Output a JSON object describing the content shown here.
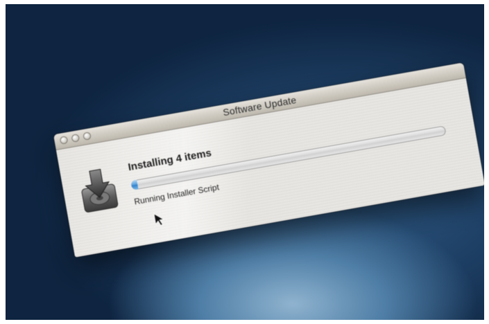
{
  "window": {
    "title": "Software Update"
  },
  "main": {
    "heading": "Installing 4 items",
    "status_text": "Running Installer Script",
    "progress_fraction": 0.02
  },
  "icons": {
    "installer": "installer-disk-icon",
    "cursor": "mouse-pointer-icon",
    "window_controls": [
      "close-button",
      "minimize-button",
      "zoom-button"
    ]
  },
  "colors": {
    "progress_fill": "#4f9bdc",
    "window_bg": "#e6e4e0",
    "titlebar_bg": "#cfcbc2"
  }
}
